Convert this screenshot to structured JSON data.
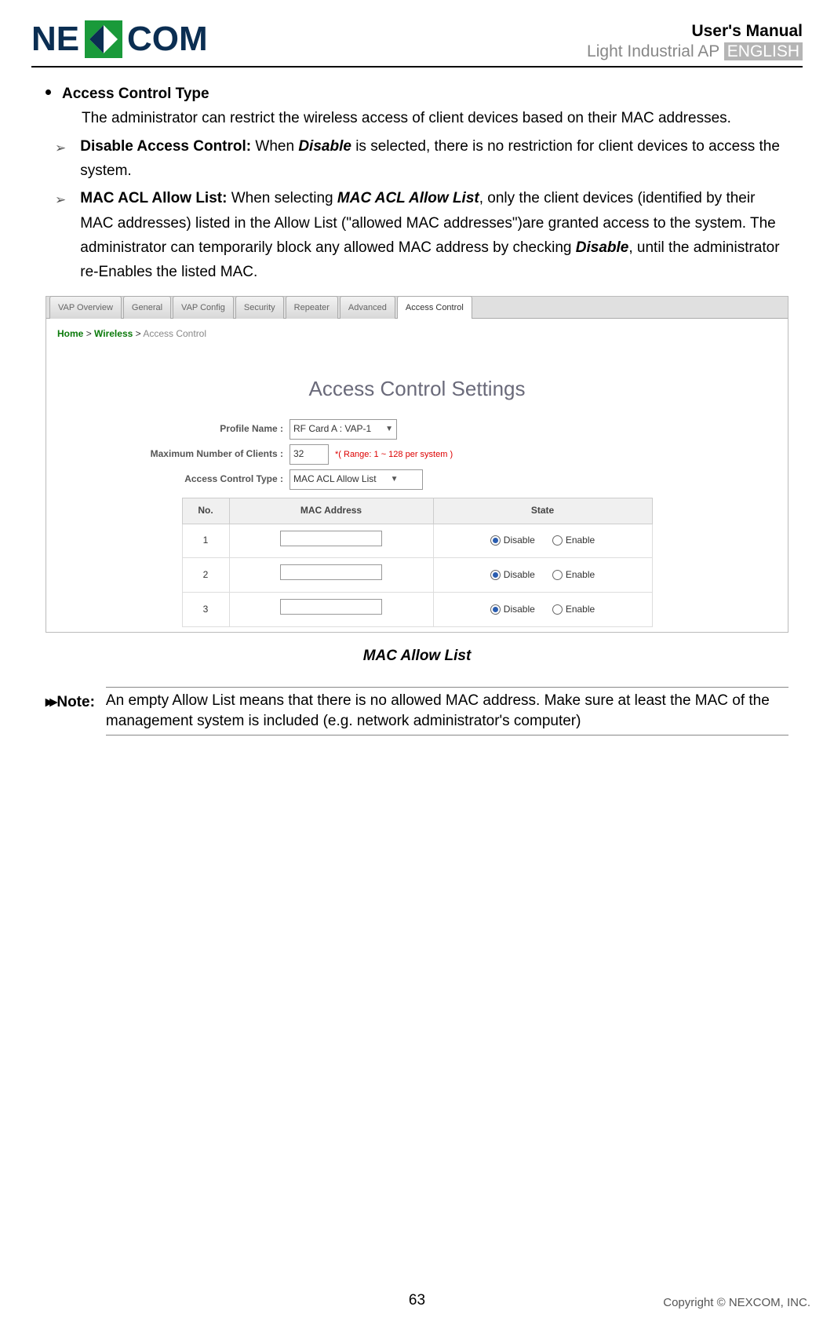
{
  "header": {
    "logo_text_left": "NE",
    "logo_text_right": "COM",
    "users_manual": "User's Manual",
    "sub_line": "Light Industrial AP",
    "sub_lang": "ENGLISH"
  },
  "section": {
    "title": "Access Control Type",
    "intro": "The administrator can restrict the wireless access of client devices based on their MAC addresses.",
    "items": [
      {
        "heading": "Disable Access Control:",
        "body_pre": " When ",
        "em1": "Disable",
        "body_post": " is selected, there is no restriction for client devices to access the system."
      },
      {
        "heading": "MAC ACL Allow List:",
        "body_pre": " When selecting ",
        "em1": "MAC ACL Allow List",
        "body_mid": ", only the client devices (identified by their MAC addresses) listed in the Allow List (\"allowed MAC addresses\")are granted access to the system. The administrator can temporarily block any allowed MAC address by checking ",
        "em2": "Disable",
        "body_post": ", until the administrator re-Enables the listed MAC."
      }
    ]
  },
  "ui": {
    "tabs": [
      "VAP Overview",
      "General",
      "VAP Config",
      "Security",
      "Repeater",
      "Advanced",
      "Access Control"
    ],
    "active_tab_index": 6,
    "breadcrumb": {
      "home": "Home",
      "sep": ">",
      "section": "Wireless",
      "current": "Access Control"
    },
    "title": "Access Control Settings",
    "form": {
      "profile_label": "Profile Name :",
      "profile_value": "RF Card A : VAP-1",
      "max_label": "Maximum Number of Clients :",
      "max_value": "32",
      "range_note": "*( Range: 1 ~ 128 per system )",
      "acl_label": "Access Control Type :",
      "acl_value": "MAC ACL Allow List"
    },
    "table": {
      "headers": [
        "No.",
        "MAC Address",
        "State"
      ],
      "state_labels": {
        "disable": "Disable",
        "enable": "Enable"
      },
      "rows": [
        {
          "no": "1",
          "mac": "",
          "state": "disable"
        },
        {
          "no": "2",
          "mac": "",
          "state": "disable"
        },
        {
          "no": "3",
          "mac": "",
          "state": "disable"
        }
      ]
    }
  },
  "caption": "MAC Allow List",
  "note": {
    "label": "Note:",
    "text": "An empty Allow List means that there is no allowed MAC address.  Make sure at least the MAC of the management system is included (e.g. network administrator's computer)"
  },
  "footer": {
    "page_number": "63",
    "copyright": "Copyright © NEXCOM, INC."
  }
}
